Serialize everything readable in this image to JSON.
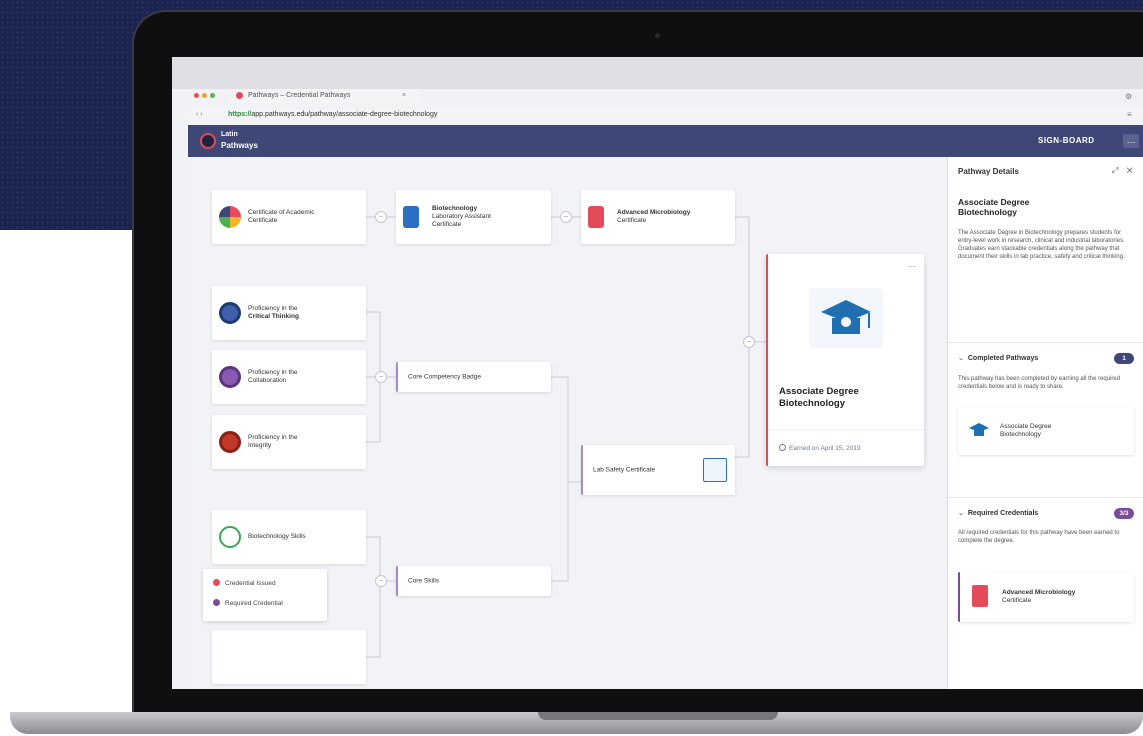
{
  "browser": {
    "tab_title": "Pathways – Credential Pathways",
    "url_secure": "https://",
    "url_rest": "app.pathways.edu/pathway/associate-degree-biotechnology",
    "gear_glyph": "⚙",
    "menu_glyph": "≡"
  },
  "app": {
    "brand_line1": "Latin",
    "brand_line2": "Pathways",
    "user_label": "SIGN-BOARD",
    "menu_glyph": "…"
  },
  "nodes": {
    "n1": {
      "line1": "Certificate of Academic",
      "line2": "Certificate"
    },
    "n2": {
      "line1": "Biotechnology",
      "line2": "Laboratory Assistant",
      "line3": "Certificate"
    },
    "n3": {
      "line1": "Advanced Microbiology",
      "line2": "Certificate"
    },
    "n4": {
      "line1": "Proficiency in the",
      "line2": "Critical Thinking"
    },
    "n5": {
      "line1": "Proficiency in the",
      "line2": "Collaboration"
    },
    "n6": {
      "line1": "Proficiency in the",
      "line2": "Integrity"
    },
    "n7": {
      "line1": "Biotechnology Skills"
    },
    "n8": {
      "line1": "Core Competency Badge"
    },
    "n9": {
      "line1": "Lab Safety Certificate"
    },
    "n10": {
      "line1": "Core Skills"
    }
  },
  "degree_card": {
    "more": "···",
    "title_line1": "Associate Degree",
    "title_line2": "Biotechnology",
    "date": "Earned on April 15, 2019"
  },
  "legend": {
    "items": [
      {
        "label": "Credential Issued",
        "color": "#e34b5a"
      },
      {
        "label": "Required Credential",
        "color": "#7b4b9b"
      }
    ]
  },
  "panel": {
    "header": "Pathway Details",
    "header_controls": "⤢ ✕",
    "title_line1": "Associate Degree",
    "title_line2": "Biotechnology",
    "description": "The Associate Degree in Biotechnology prepares students for entry-level work in research, clinical and industrial laboratories. Graduates earn stackable credentials along the pathway that document their skills in lab practice, safety and critical thinking.",
    "completed_label": "Completed Pathways",
    "completed_count": "1",
    "completed_text": "This pathway has been completed by earning all the required credentials below and is ready to share.",
    "completed_card_line1": "Associate Degree",
    "completed_card_line2": "Biotechnology",
    "required_label": "Required Credentials",
    "required_count": "3/3",
    "required_text": "All required credentials for this pathway have been earned to complete the degree.",
    "required_card_line1": "Advanced Microbiology",
    "required_card_line2": "Certificate"
  },
  "colors": {
    "header": "#3f4776",
    "accent_red": "#e34b5a",
    "accent_purple": "#7b4b9b",
    "badge_navy": "#3f4776"
  }
}
